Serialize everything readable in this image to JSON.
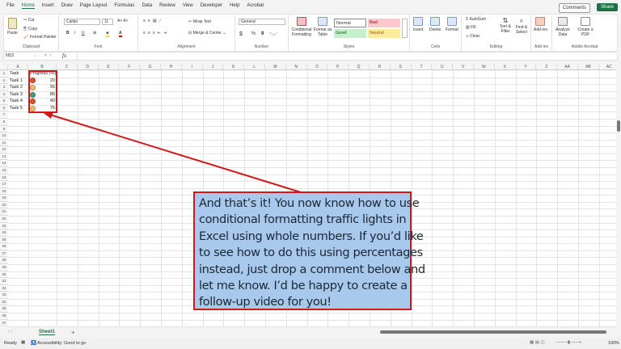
{
  "menu": [
    "File",
    "Home",
    "Insert",
    "Draw",
    "Page Layout",
    "Formulas",
    "Data",
    "Review",
    "View",
    "Developer",
    "Help",
    "Acrobat"
  ],
  "active_tab": "Home",
  "topbar": {
    "comments": "Comments",
    "share": "Share"
  },
  "ribbon": {
    "clipboard": {
      "label": "Clipboard",
      "paste": "Paste",
      "cut": "Cut",
      "copy": "Copy",
      "format_painter": "Format Painter"
    },
    "font": {
      "label": "Font",
      "name": "Calibri",
      "size": "11",
      "bold": "B",
      "italic": "I",
      "underline": "U"
    },
    "alignment": {
      "label": "Alignment",
      "wrap": "Wrap Text",
      "merge": "Merge & Center"
    },
    "number": {
      "label": "Number",
      "format": "General",
      "currency": "$",
      "percent": "%",
      "comma": "9"
    },
    "styles": {
      "label": "Styles",
      "conditional": "Conditional Formatting",
      "format_table": "Format as Table",
      "normal": "Normal",
      "bad": "Bad",
      "good": "Good",
      "neutral": "Neutral"
    },
    "cells": {
      "label": "Cells",
      "insert": "Insert",
      "delete": "Delete",
      "format": "Format"
    },
    "editing": {
      "label": "Editing",
      "autosum": "AutoSum",
      "fill": "Fill",
      "clear": "Clear",
      "sort": "Sort & Filter",
      "find": "Find & Select"
    },
    "addins": {
      "label": "Add-ins",
      "addins": "Add-ins",
      "analyze": "Analyze Data"
    },
    "acrobat": {
      "label": "Adobe Acrobat",
      "create": "Create a PDF"
    }
  },
  "formula_bar": {
    "name_box": "N53",
    "fx": "fx",
    "value": ""
  },
  "columns": [
    "A",
    "B",
    "C",
    "D",
    "E",
    "F",
    "G",
    "H",
    "I",
    "J",
    "K",
    "L",
    "M",
    "N",
    "O",
    "P",
    "Q",
    "R",
    "S",
    "T",
    "U",
    "V",
    "W",
    "X",
    "Y",
    "Z",
    "AA",
    "AB",
    "AC"
  ],
  "row_count": 37,
  "table": {
    "headers": [
      "Task",
      "Progress (%)"
    ],
    "rows": [
      {
        "task": "Task 1",
        "progress": 20,
        "light": "red"
      },
      {
        "task": "Task 2",
        "progress": 55,
        "light": "yellow"
      },
      {
        "task": "Task 3",
        "progress": 85,
        "light": "green"
      },
      {
        "task": "Task 4",
        "progress": 40,
        "light": "red"
      },
      {
        "task": "Task 5",
        "progress": 75,
        "light": "yellow"
      }
    ]
  },
  "colors": {
    "red": "#d9532f",
    "yellow": "#e8c06a",
    "green": "#4f9a7c",
    "highlight": "#d01a1a",
    "callout_fill": "#a8c8ec",
    "excel_green": "#1e7145"
  },
  "callout": {
    "lines": [
      "And that’s it! You now know how to use",
      "conditional formatting traffic lights in",
      "Excel using whole numbers. If you’d like",
      "to see how to do this using percentages",
      "instead, just drop a comment below and",
      "let me know. I’d be happy to create a",
      "follow-up video for you!"
    ]
  },
  "sheet_tabs": [
    "Sheet1"
  ],
  "status": {
    "ready": "Ready",
    "accessibility": "Accessibility: Good to go",
    "zoom": "100%"
  }
}
